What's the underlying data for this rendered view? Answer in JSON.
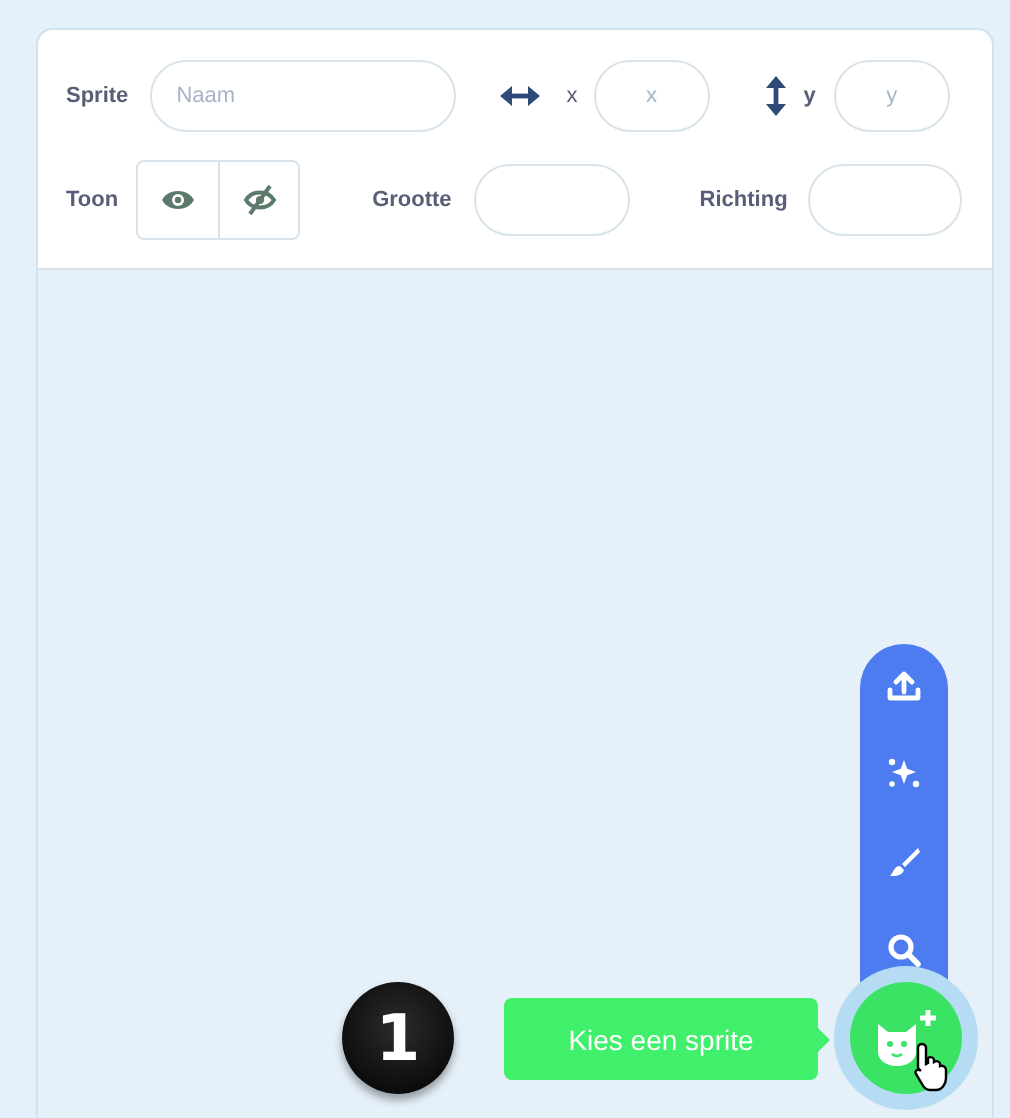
{
  "sprite_info": {
    "sprite": {
      "label": "Sprite",
      "placeholder": "Naam"
    },
    "x": {
      "label": "x",
      "placeholder": "x"
    },
    "y": {
      "label": "y",
      "placeholder": "y"
    },
    "show": {
      "label": "Toon"
    },
    "size": {
      "label": "Grootte"
    },
    "direction": {
      "label": "Richting"
    }
  },
  "step_badge": "1",
  "sprite_menu": {
    "tooltip": "Kies een sprite",
    "items": [
      {
        "kind": "upload"
      },
      {
        "kind": "surprise"
      },
      {
        "kind": "paint"
      },
      {
        "kind": "search"
      }
    ]
  }
}
